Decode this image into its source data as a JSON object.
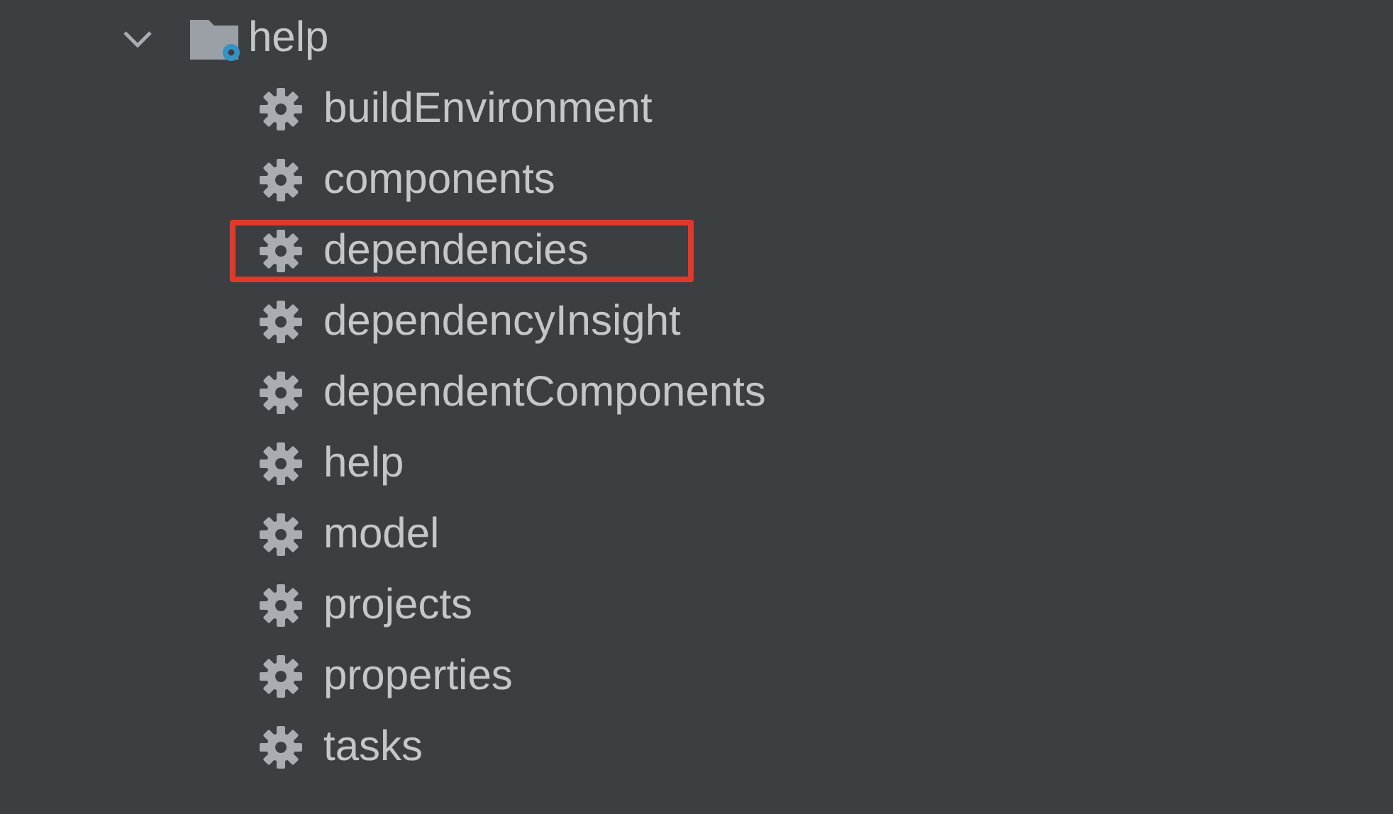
{
  "tree": [
    {
      "label": "help",
      "kind": "folder",
      "expanded": true,
      "children": [
        {
          "label": "buildEnvironment",
          "kind": "task",
          "highlighted": false
        },
        {
          "label": "components",
          "kind": "task",
          "highlighted": false
        },
        {
          "label": "dependencies",
          "kind": "task",
          "highlighted": true
        },
        {
          "label": "dependencyInsight",
          "kind": "task",
          "highlighted": false
        },
        {
          "label": "dependentComponents",
          "kind": "task",
          "highlighted": false
        },
        {
          "label": "help",
          "kind": "task",
          "highlighted": false
        },
        {
          "label": "model",
          "kind": "task",
          "highlighted": false
        },
        {
          "label": "projects",
          "kind": "task",
          "highlighted": false
        },
        {
          "label": "properties",
          "kind": "task",
          "highlighted": false
        },
        {
          "label": "tasks",
          "kind": "task",
          "highlighted": false
        }
      ]
    }
  ]
}
